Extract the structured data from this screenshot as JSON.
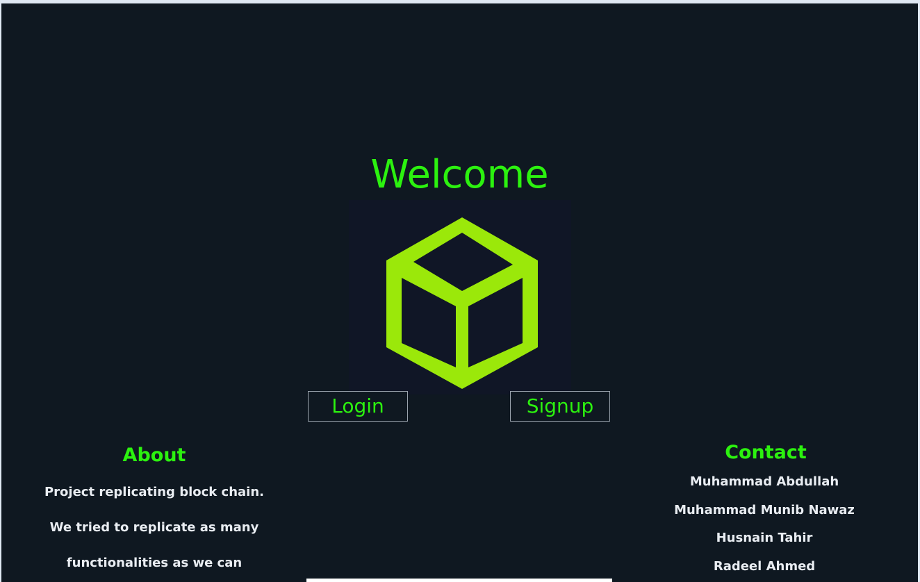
{
  "hero": {
    "title": "Welcome",
    "logo_icon": "cube-icon",
    "logo_color": "#9be80a"
  },
  "actions": {
    "login_label": "Login",
    "signup_label": "Signup"
  },
  "about": {
    "title": "About",
    "lines": [
      "Project replicating block chain.",
      "We tried to replicate as many",
      "functionalities as we can"
    ]
  },
  "contact": {
    "title": "Contact",
    "names": [
      "Muhammad Abdullah",
      "Muhammad Munib Nawaz",
      "Husnain Tahir",
      "Radeel Ahmed"
    ]
  },
  "theme": {
    "background": "#0f1821",
    "accent": "#2cf20f",
    "text": "#e9edf2"
  }
}
